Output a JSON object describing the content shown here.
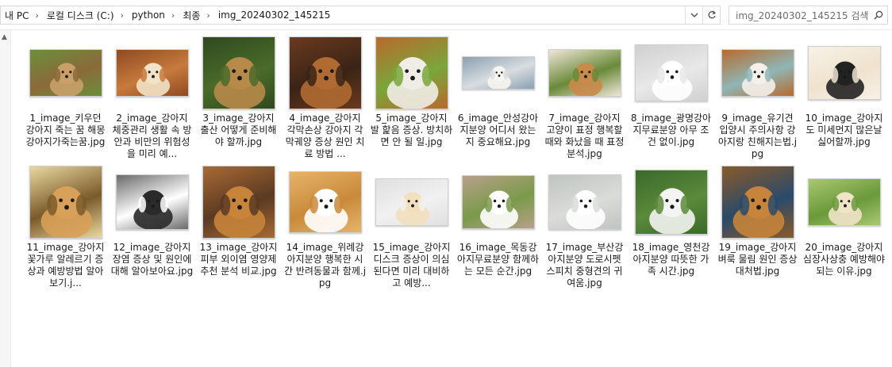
{
  "breadcrumb": {
    "items": [
      "내 PC",
      "로컬 디스크 (C:)",
      "python",
      "최종",
      "img_20240302_145215"
    ]
  },
  "search": {
    "placeholder": "img_20240302_145215 검색"
  },
  "icons": {
    "dropdown": "chevron-down-icon",
    "refresh": "refresh-icon",
    "search": "search-icon",
    "scroll_up": "scroll-up-icon"
  },
  "files": [
    {
      "label": "1_image_키우던 강아지 죽는 꿈 해몽 강아지가죽는꿈.jpg",
      "thumb": {
        "w": 92,
        "h": 60,
        "c1": "#8a6a3a",
        "c2": "#c9a069",
        "c3": "#6b8f3a"
      }
    },
    {
      "label": "2_image_강아지 체중관리 생활 속 방안과 비만의 위험성을 미리 예...",
      "thumb": {
        "w": 92,
        "h": 60,
        "c1": "#c77a3c",
        "c2": "#f2e2c7",
        "c3": "#8e4a22"
      }
    },
    {
      "label": "3_image_강아지 출산 어떻게 준비해야 할까.jpg",
      "thumb": {
        "w": 92,
        "h": 92,
        "c1": "#4a6b2a",
        "c2": "#b88a4a",
        "c3": "#2f4a1e"
      }
    },
    {
      "label": "4_image_강아지 각막손상 강아지 각막궤양 증상 원인 치료 방법 ...",
      "thumb": {
        "w": 92,
        "h": 92,
        "c1": "#3a2416",
        "c2": "#b06a32",
        "c3": "#6a3a1e"
      }
    },
    {
      "label": "5_image_강아지 발 핥음 증상. 방치하면 안 될 일.jpg",
      "thumb": {
        "w": 92,
        "h": 92,
        "c1": "#7aa63a",
        "c2": "#f0ede6",
        "c3": "#b86a2e"
      }
    },
    {
      "label": "6_image_안성강아지분양 어디서 왔는지 중요해요.jpg",
      "thumb": {
        "w": 92,
        "h": 42,
        "c1": "#d8dde0",
        "c2": "#f7f5f1",
        "c3": "#8aa0b0"
      }
    },
    {
      "label": "7_image_강아지 고양이 표정 행복할때와 화났을 때 표정분석.jpg",
      "thumb": {
        "w": 92,
        "h": 60,
        "c1": "#6a8a3a",
        "c2": "#c98a4a",
        "c3": "#f0e6d8"
      }
    },
    {
      "label": "8_image_광명강아지무료분양 아무 조건 없이.jpg",
      "thumb": {
        "w": 92,
        "h": 72,
        "c1": "#e8e8e8",
        "c2": "#ffffff",
        "c3": "#d0d0d0"
      }
    },
    {
      "label": "9_image_유기견 입양시 주의사항 강아지랑 친해지는법.jpg",
      "thumb": {
        "w": 92,
        "h": 60,
        "c1": "#8fb6b6",
        "c2": "#f4f0ea",
        "c3": "#b86a2e"
      }
    },
    {
      "label": "10_image_강아지도 미세먼지 많은날 싫어할까.jpg",
      "thumb": {
        "w": 92,
        "h": 68,
        "c1": "#efe3cf",
        "c2": "#222222",
        "c3": "#f7f1e6"
      }
    },
    {
      "label": "11_image_강아지 꽃가루 알레르기 증상과 예방방법 알아보기.j...",
      "thumb": {
        "w": 92,
        "h": 92,
        "c1": "#7a5a2a",
        "c2": "#d8a058",
        "c3": "#e9d9a0"
      }
    },
    {
      "label": "12_image_강아지장염 증상 및 원인에 대해 알아보아요.jpg",
      "thumb": {
        "w": 92,
        "h": 70,
        "c1": "#ffffff",
        "c2": "#2a2a2a",
        "c3": "#6a6a6a"
      }
    },
    {
      "label": "13_image_강아지 피부 외이염 영양제 추천 분석 비교.jpg",
      "thumb": {
        "w": 92,
        "h": 92,
        "c1": "#5a3a22",
        "c2": "#c7843a",
        "c3": "#a86a34"
      }
    },
    {
      "label": "14_image_위례강아지분양 행복한 시간 반려동물과 함께.jpg",
      "thumb": {
        "w": 92,
        "h": 78,
        "c1": "#c98a3a",
        "c2": "#ffffff",
        "c3": "#e6b46a"
      }
    },
    {
      "label": "15_image_강아지 디스크 증상이 의심된다면 미리 대비하고 예방...",
      "thumb": {
        "w": 92,
        "h": 60,
        "c1": "#f1f1f1",
        "c2": "#f2dfbe",
        "c3": "#e0e0e0"
      }
    },
    {
      "label": "16_image_목동강아지무료분양 함께하는 모든 순간.jpg",
      "thumb": {
        "w": 92,
        "h": 68,
        "c1": "#7a9a4a",
        "c2": "#ffffff",
        "c3": "#b8a08a"
      }
    },
    {
      "label": "17_image_부산강아지분양 도로시펫 스피치 중형견의 귀여움.jpg",
      "thumb": {
        "w": 92,
        "h": 70,
        "c1": "#d9dcd9",
        "c2": "#ffffff",
        "c3": "#c0c4c0"
      }
    },
    {
      "label": "18_image_영천강아지분양 따뜻한 가족 시간.jpg",
      "thumb": {
        "w": 92,
        "h": 82,
        "c1": "#5a8a3a",
        "c2": "#f4f4f2",
        "c3": "#3a6a2a"
      }
    },
    {
      "label": "19_image_강아지벼룩 물림 원인 증상 대처법.jpg",
      "thumb": {
        "w": 92,
        "h": 92,
        "c1": "#2a4a6a",
        "c2": "#c7843a",
        "c3": "#8a5a2a"
      }
    },
    {
      "label": "20_image_강아지심장사상충 예방해야 되는 이유.jpg",
      "thumb": {
        "w": 92,
        "h": 60,
        "c1": "#6a9a3a",
        "c2": "#efe3c8",
        "c3": "#a8c870"
      }
    }
  ]
}
